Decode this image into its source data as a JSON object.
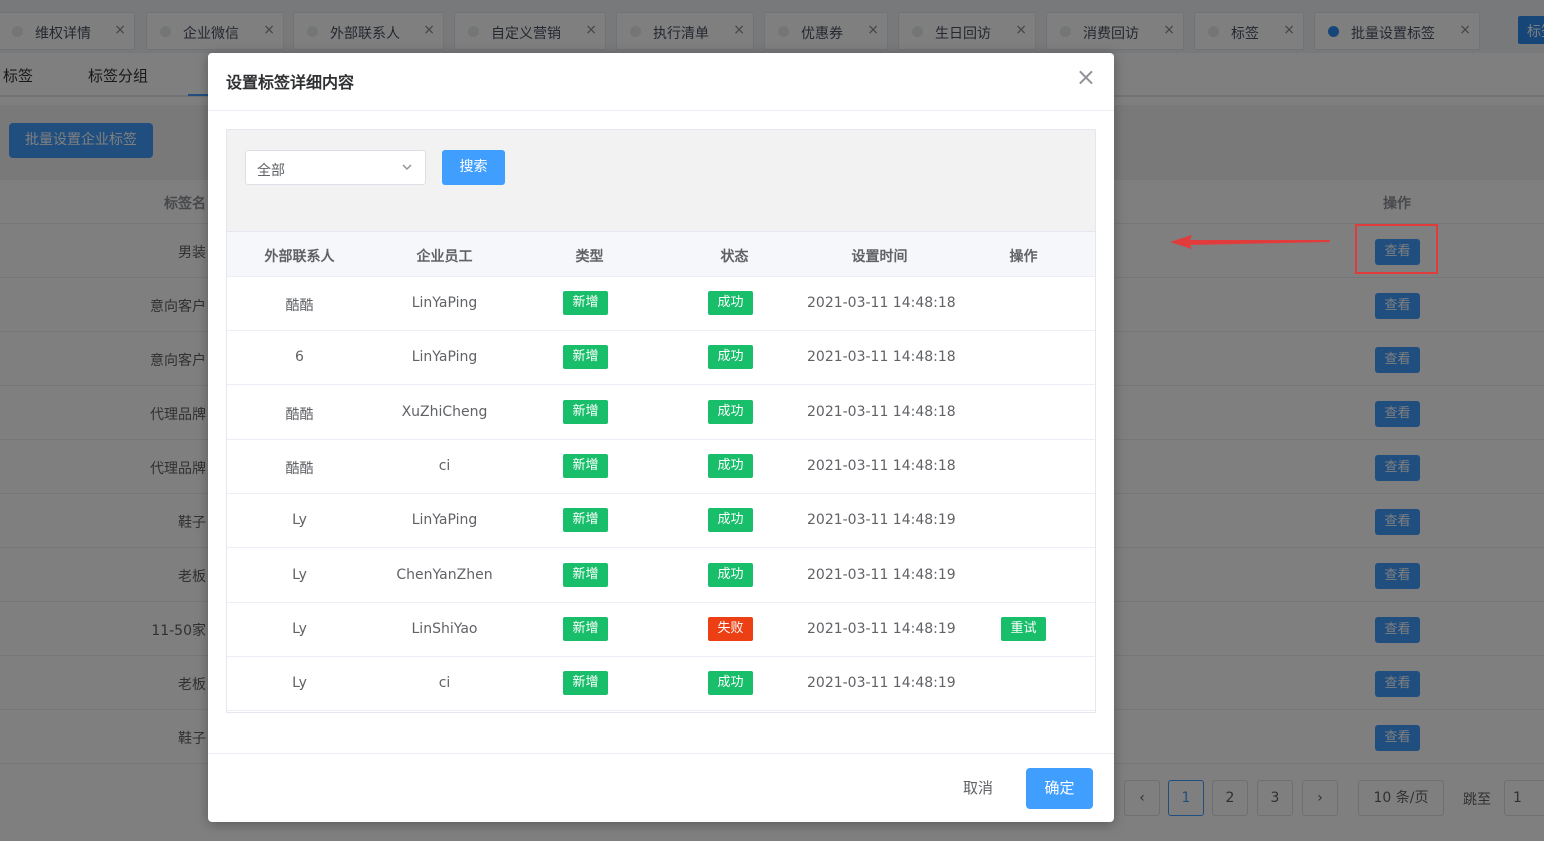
{
  "tabs": [
    {
      "label": "维权详情"
    },
    {
      "label": "企业微信"
    },
    {
      "label": "外部联系人"
    },
    {
      "label": "自定义营销"
    },
    {
      "label": "执行清单"
    },
    {
      "label": "优惠券"
    },
    {
      "label": "生日回访"
    },
    {
      "label": "消费回访"
    },
    {
      "label": "标签"
    },
    {
      "label": "批量设置标签"
    }
  ],
  "tab_close": "×",
  "tab_more": "标签",
  "subtabs": [
    "标签",
    "标签分组"
  ],
  "toolbar": {
    "batch_button": "批量设置企业标签"
  },
  "bg_table": {
    "header_name": "标签名称",
    "header_action": "操作",
    "view_label": "查看",
    "rows": [
      "男装",
      "意向客户",
      "意向客户",
      "代理品牌",
      "代理品牌",
      "鞋子",
      "老板",
      "11-50家",
      "老板",
      "鞋子"
    ]
  },
  "pagination": {
    "pages": [
      "1",
      "2",
      "3"
    ],
    "prev": "‹",
    "next": "›",
    "page_size": "10 条/页",
    "jump_label": "跳至",
    "jump_value": "1"
  },
  "modal": {
    "title": "设置标签详细内容",
    "close": "×",
    "filter": {
      "select_value": "全部",
      "search_button": "搜索"
    },
    "columns": [
      "外部联系人",
      "企业员工",
      "类型",
      "状态",
      "设置时间",
      "操作"
    ],
    "rows": [
      {
        "contact": "酷酷",
        "employee": "LinYaPing",
        "type": "新增",
        "status": "成功",
        "time": "2021-03-11 14:48:18",
        "action": ""
      },
      {
        "contact": "6",
        "employee": "LinYaPing",
        "type": "新增",
        "status": "成功",
        "time": "2021-03-11 14:48:18",
        "action": ""
      },
      {
        "contact": "酷酷",
        "employee": "XuZhiCheng",
        "type": "新增",
        "status": "成功",
        "time": "2021-03-11 14:48:18",
        "action": ""
      },
      {
        "contact": "酷酷",
        "employee": "ci",
        "type": "新增",
        "status": "成功",
        "time": "2021-03-11 14:48:18",
        "action": ""
      },
      {
        "contact": "Ly",
        "employee": "LinYaPing",
        "type": "新增",
        "status": "成功",
        "time": "2021-03-11 14:48:19",
        "action": ""
      },
      {
        "contact": "Ly",
        "employee": "ChenYanZhen",
        "type": "新增",
        "status": "成功",
        "time": "2021-03-11 14:48:19",
        "action": ""
      },
      {
        "contact": "Ly",
        "employee": "LinShiYao",
        "type": "新增",
        "status": "失败",
        "time": "2021-03-11 14:48:19",
        "action": "重试"
      },
      {
        "contact": "Ly",
        "employee": "ci",
        "type": "新增",
        "status": "成功",
        "time": "2021-03-11 14:48:19",
        "action": ""
      }
    ],
    "cancel_button": "取消",
    "ok_button": "确定"
  },
  "colors": {
    "primary": "#409eff",
    "success": "#19be6b",
    "error": "#ed3f14",
    "callout": "#e23b3b"
  },
  "icons": {
    "select_caret": "chevron-down-icon",
    "close": "close-icon",
    "callout_arrow": "arrow-left-icon"
  }
}
